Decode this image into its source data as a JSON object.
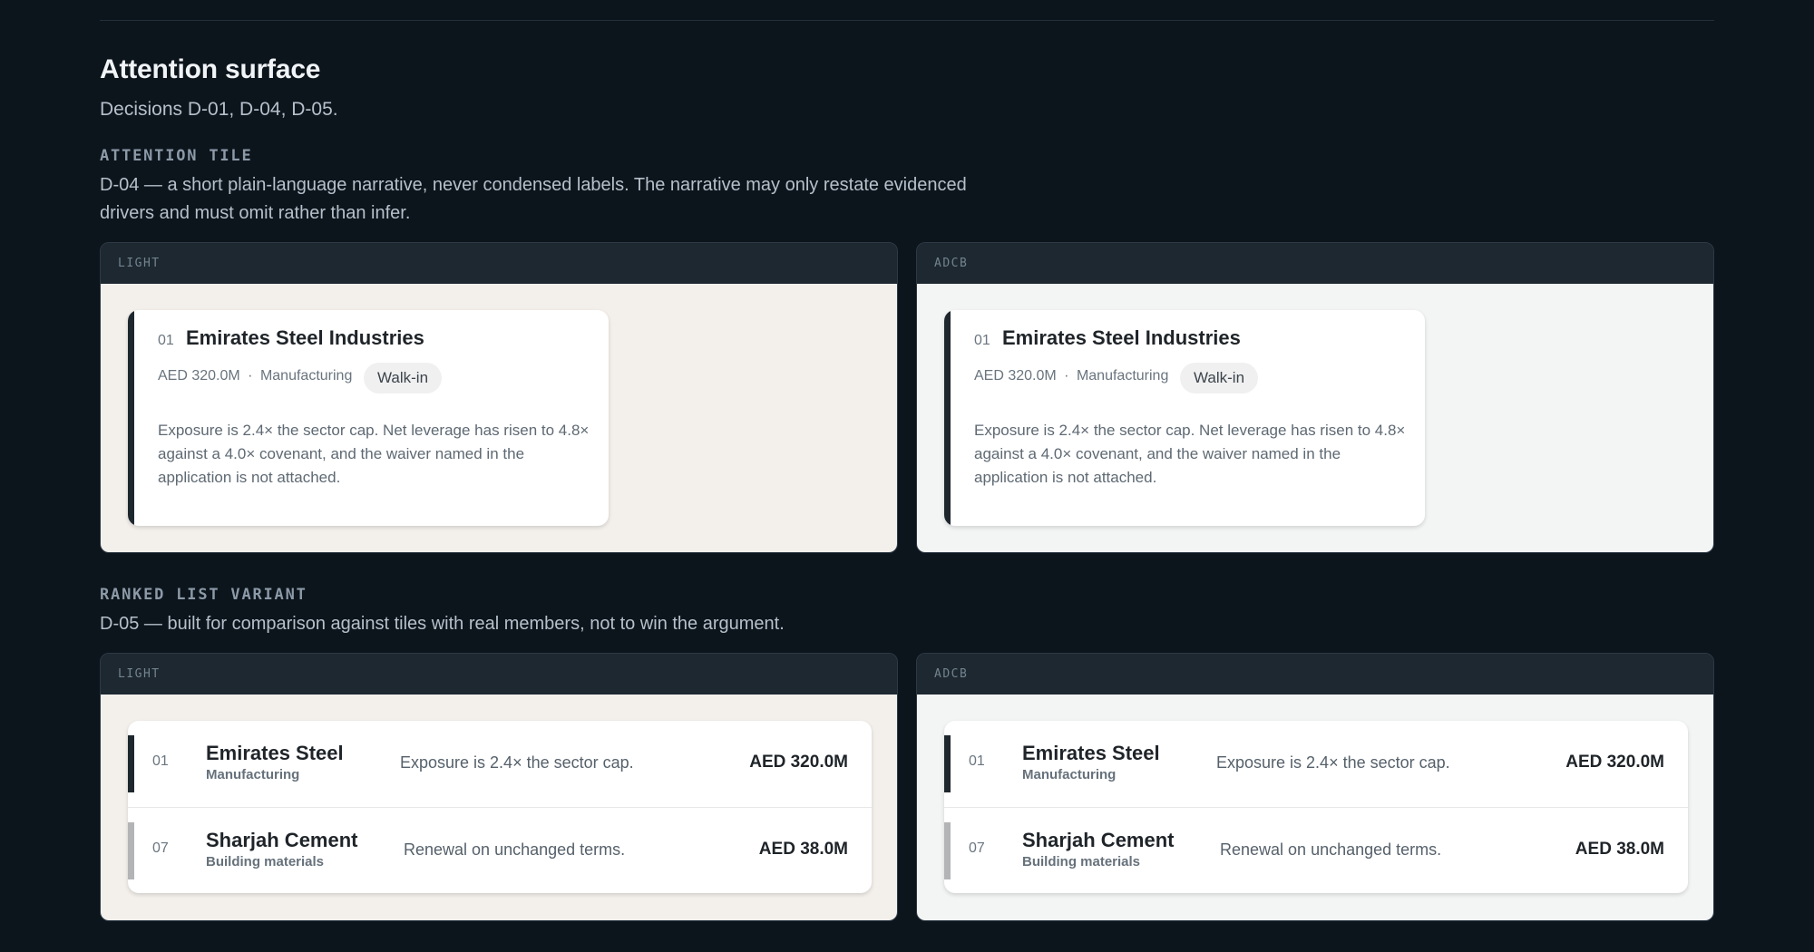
{
  "section": {
    "title": "Attention surface",
    "subtitle": "Decisions D-01, D-04, D-05."
  },
  "attention_tile": {
    "eyebrow": "ATTENTION TILE",
    "description": "D-04 — a short plain-language narrative, never condensed labels. The narrative may only restate evidenced drivers and must omit rather than infer.",
    "themes": [
      {
        "label": "LIGHT",
        "tile": {
          "rank": "01",
          "name": "Emirates Steel Industries",
          "amount": "AED 320.0M",
          "sep": "·",
          "sector": "Manufacturing",
          "badge": "Walk-in",
          "narrative": "Exposure is 2.4× the sector cap. Net leverage has risen to 4.8× against a 4.0× covenant, and the waiver named in the application is not attached."
        }
      },
      {
        "label": "ADCB",
        "tile": {
          "rank": "01",
          "name": "Emirates Steel Industries",
          "amount": "AED 320.0M",
          "sep": "·",
          "sector": "Manufacturing",
          "badge": "Walk-in",
          "narrative": "Exposure is 2.4× the sector cap. Net leverage has risen to 4.8× against a 4.0× covenant, and the waiver named in the application is not attached."
        }
      }
    ]
  },
  "ranked_list": {
    "eyebrow": "RANKED LIST VARIANT",
    "description": "D-05 — built for comparison against tiles with real members, not to win the argument.",
    "themes": [
      {
        "label": "LIGHT",
        "rows": [
          {
            "rank": "01",
            "name": "Emirates Steel",
            "sector": "Manufacturing",
            "narrative": "Exposure is 2.4× the sector cap.",
            "amount": "AED 320.0M",
            "bar_color": "#1e272e"
          },
          {
            "rank": "07",
            "name": "Sharjah Cement",
            "sector": "Building materials",
            "narrative": "Renewal on unchanged terms.",
            "amount": "AED 38.0M",
            "bar_color": "#b3b4b6"
          }
        ]
      },
      {
        "label": "ADCB",
        "rows": [
          {
            "rank": "01",
            "name": "Emirates Steel",
            "sector": "Manufacturing",
            "narrative": "Exposure is 2.4× the sector cap.",
            "amount": "AED 320.0M",
            "bar_color": "#1e272e"
          },
          {
            "rank": "07",
            "name": "Sharjah Cement",
            "sector": "Building materials",
            "narrative": "Renewal on unchanged terms.",
            "amount": "AED 38.0M",
            "bar_color": "#b3b4b6"
          }
        ]
      }
    ]
  },
  "colors": {
    "page_bg": "#0c141c",
    "light_surface": "#f3efeb",
    "adcb_surface": "#f3f4f4",
    "severity_high": "#1e272e",
    "severity_low": "#b3b4b6"
  }
}
